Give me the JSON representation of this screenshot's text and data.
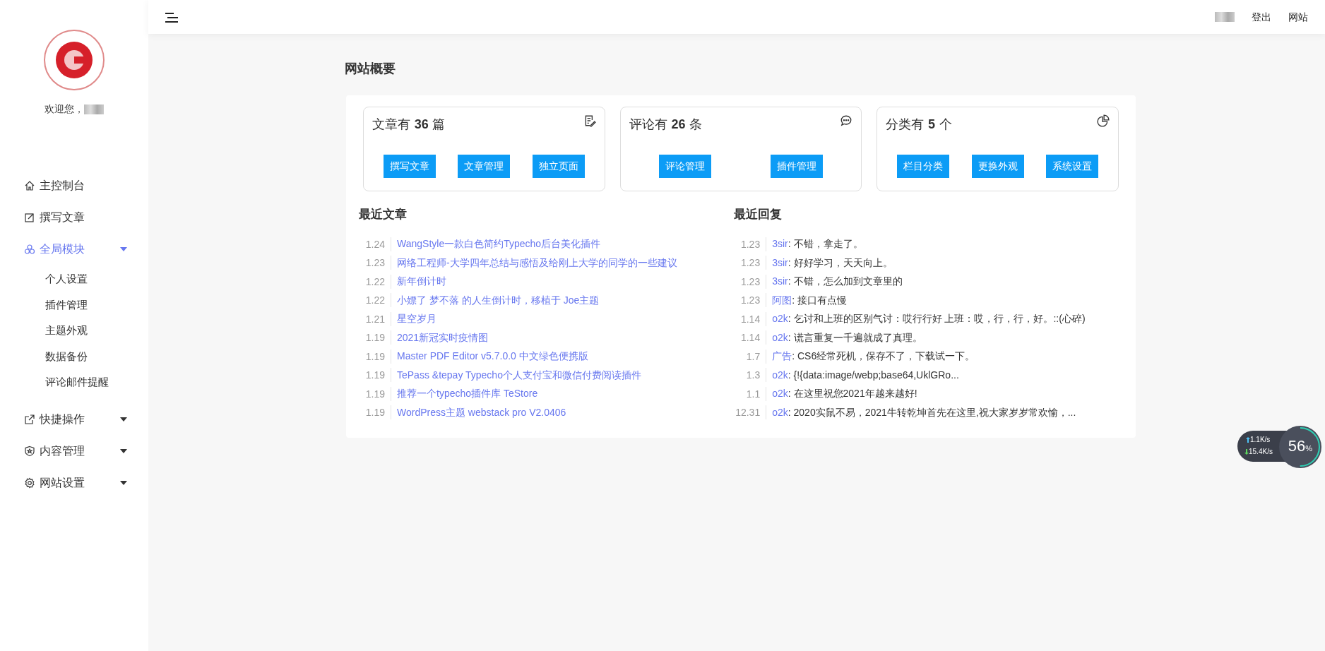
{
  "topbar": {
    "links": [
      "登出",
      "网站"
    ]
  },
  "sidebar": {
    "welcome": "欢迎您，",
    "items": [
      {
        "label": "主控制台",
        "kind": "link"
      },
      {
        "label": "撰写文章",
        "kind": "link"
      },
      {
        "label": "全局模块",
        "kind": "group",
        "expanded": true,
        "children": [
          {
            "label": "个人设置"
          },
          {
            "label": "插件管理"
          },
          {
            "label": "主题外观"
          },
          {
            "label": "数据备份"
          },
          {
            "label": "评论邮件提醒"
          }
        ]
      },
      {
        "label": "快捷操作",
        "kind": "group",
        "expanded": false
      },
      {
        "label": "内容管理",
        "kind": "group",
        "expanded": false
      },
      {
        "label": "网站设置",
        "kind": "group",
        "expanded": false
      }
    ]
  },
  "page_title": "网站概要",
  "stats": [
    {
      "prefix": "文章有",
      "count": "36",
      "unit": "篇",
      "buttons": [
        "撰写文章",
        "文章管理",
        "独立页面"
      ]
    },
    {
      "prefix": "评论有",
      "count": "26",
      "unit": "条",
      "buttons": [
        "评论管理",
        "插件管理"
      ]
    },
    {
      "prefix": "分类有",
      "count": "5",
      "unit": "个",
      "buttons": [
        "栏目分类",
        "更换外观",
        "系统设置"
      ]
    }
  ],
  "recent_posts": {
    "title": "最近文章",
    "rows": [
      {
        "date": "1.24",
        "title": "WangStyle一款白色简约Typecho后台美化插件"
      },
      {
        "date": "1.23",
        "title": "网络工程师-大学四年总结与感悟及给刚上大学的同学的一些建议"
      },
      {
        "date": "1.22",
        "title": "新年倒计时"
      },
      {
        "date": "1.22",
        "title": "小嫖了 梦不落 的人生倒计时，移植于 Joe主题"
      },
      {
        "date": "1.21",
        "title": "星空岁月"
      },
      {
        "date": "1.19",
        "title": "2021新冠实时疫情图"
      },
      {
        "date": "1.19",
        "title": "Master PDF Editor v5.7.0.0 中文绿色便携版"
      },
      {
        "date": "1.19",
        "title": "TePass &tepay Typecho个人支付宝和微信付费阅读插件"
      },
      {
        "date": "1.19",
        "title": "推荐一个typecho插件库 TeStore"
      },
      {
        "date": "1.19",
        "title": "WordPress主题 webstack pro V2.0406"
      }
    ]
  },
  "recent_replies": {
    "title": "最近回复",
    "rows": [
      {
        "date": "1.23",
        "author": "3sir",
        "text": ": 不错，拿走了。"
      },
      {
        "date": "1.23",
        "author": "3sir",
        "text": ": 好好学习，天天向上。"
      },
      {
        "date": "1.23",
        "author": "3sir",
        "text": ": 不错，怎么加到文章里的"
      },
      {
        "date": "1.23",
        "author": "阿图",
        "text": ": 接口有点慢"
      },
      {
        "date": "1.14",
        "author": "o2k",
        "text": ": 乞讨和上班的区别气讨：哎行行好 上班：哎，行，行，好。::(心碎)"
      },
      {
        "date": "1.14",
        "author": "o2k",
        "text": ": 谎言重复一千遍就成了真理。"
      },
      {
        "date": "1.7",
        "author": "广告",
        "text": ": CS6经常死机，保存不了，下载试一下。"
      },
      {
        "date": "1.3",
        "author": "o2k",
        "text": ": {!{data:image/webp;base64,UklGRo..."
      },
      {
        "date": "1.1",
        "author": "o2k",
        "text": ": 在这里祝您2021年越来越好!"
      },
      {
        "date": "12.31",
        "author": "o2k",
        "text": ": 2020实鼠不易，2021牛转乾坤首先在这里,祝大家岁岁常欢愉，..."
      }
    ]
  },
  "net_widget": {
    "upload": "1.1",
    "upload_unit": "K/s",
    "download": "15.4",
    "download_unit": "K/s",
    "percent": "56",
    "percent_unit": "%"
  }
}
